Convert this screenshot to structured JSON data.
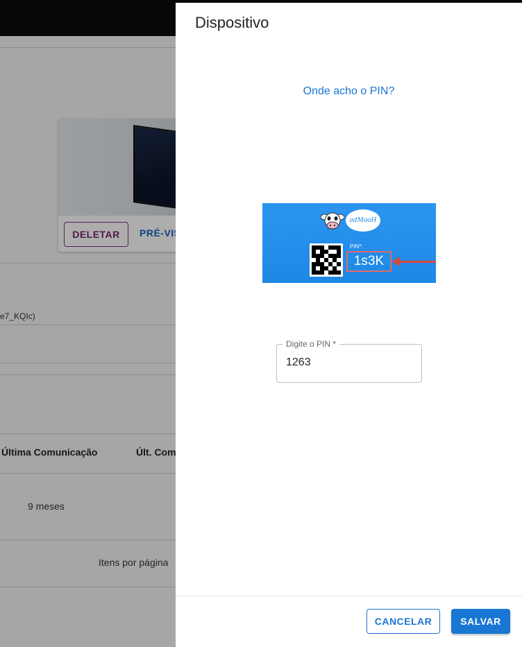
{
  "background": {
    "card_delete_label": "DELETAR",
    "card_preview_label": "PRÉ-VIS",
    "field_value": "e7_KQIc)",
    "table": {
      "headers": [
        "Última Comunicação",
        "Últ. Com"
      ],
      "cell": "9 meses"
    },
    "pager_label": "Itens por página"
  },
  "dialog": {
    "title": "Dispositivo",
    "help_link": "Onde acho o PIN?",
    "pin_image": {
      "brand": "adMooH",
      "pin_label": "PIN*:",
      "pin_code": "1s3K"
    },
    "pin_field": {
      "label": "Digite o PIN *",
      "value": "1263"
    },
    "cancel_label": "CANCELAR",
    "save_label": "SALVAR",
    "colors": {
      "primary": "#1976d2",
      "image_background": "#1e88e5",
      "arrow": "#d9463e"
    }
  }
}
